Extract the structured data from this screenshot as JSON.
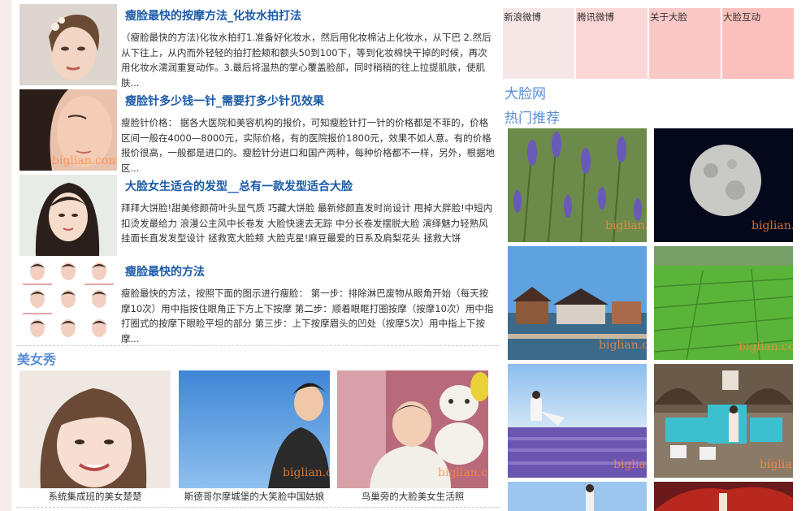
{
  "articles": [
    {
      "title": "瘦脸最快的按摩方法_化妆水拍打法",
      "summary": "（瘦脸最快的方法)化妆水拍打1.准备好化妆水，然后用化妆棉沾上化妆水，从下巴 2.然后从下往上，从内而外轻轻的拍打脸颊和额头50到100下，等到化妆棉快干掉的时候，再次用化妆水濡润重复动作。3.最后将温热的掌心覆盖脸部，同时稍稍的往上拉提肌肤，使肌肤..."
    },
    {
      "title": "瘦脸针多少钱一针_需要打多少针见效果",
      "summary": "瘦脸针价格：  据各大医院和美容机构的报价，可知瘦脸针打一针的价格都是不菲的，价格区间一般在4000—8000元，实际价格，有的医院报价1800元，效果不如人意。有的价格报价很高，一般都是进口的。瘦脸针分进口和国产两种，每种价格都不一样，另外，根据地区..."
    },
    {
      "title": "大脸女生适合的发型__总有一款发型适合大脸",
      "summary": "拜拜大饼脸!甜美修颜荷叶头显气质 巧藏大饼脸 最新修颜直发时尚设计 甩掉大胖脸!中短内扣烫发最给力 浪漫公主风中长卷发 大脸快速去无踪 中分长卷发摆脱大脸 演绎魅力轻熟风 挂面长直发发型设计 拯救宽大脸颊 大脸克星!麻豆最爱的日系及肩梨花头 拯救大饼"
    },
    {
      "title": "瘦脸最快的方法",
      "summary": "瘦脸最快的方法，按照下面的图示进行瘦脸：  第一步：排除淋巴废物从眼角开始（每天按摩10次）用中指按住眼角正下方上下按摩 第二步：顺着眼眶打圈按摩（按摩10次）用中指打圈式的按摩下眼睑平坦的部分 第三步：上下按摩眉头的凹处（按摩5次）用中指上下按摩..."
    }
  ],
  "beauty_section": {
    "title": "美女秀",
    "photos": [
      {
        "caption": "系统集成班的美女楚楚"
      },
      {
        "caption": "斯德哥尔摩城堡的大笑脸中国姑娘"
      },
      {
        "caption": "鸟巢旁的大脸美女生活照"
      }
    ]
  },
  "links": [
    {
      "label": "新浪微博",
      "bg": "#f7e6e6"
    },
    {
      "label": "腾讯微博",
      "bg": "#fbd6d6"
    },
    {
      "label": "关于大脸",
      "bg": "#fbc8c8"
    },
    {
      "label": "大脸互动",
      "bg": "#fcc0bc"
    }
  ],
  "right": {
    "site_name": "大脸网",
    "hot_title": "热门推荐"
  },
  "watermark": "biglian.com",
  "colors": {
    "title_link": "#1a5aa8",
    "section_title": "#5b8fd6",
    "watermark": "#ff8a3d"
  }
}
